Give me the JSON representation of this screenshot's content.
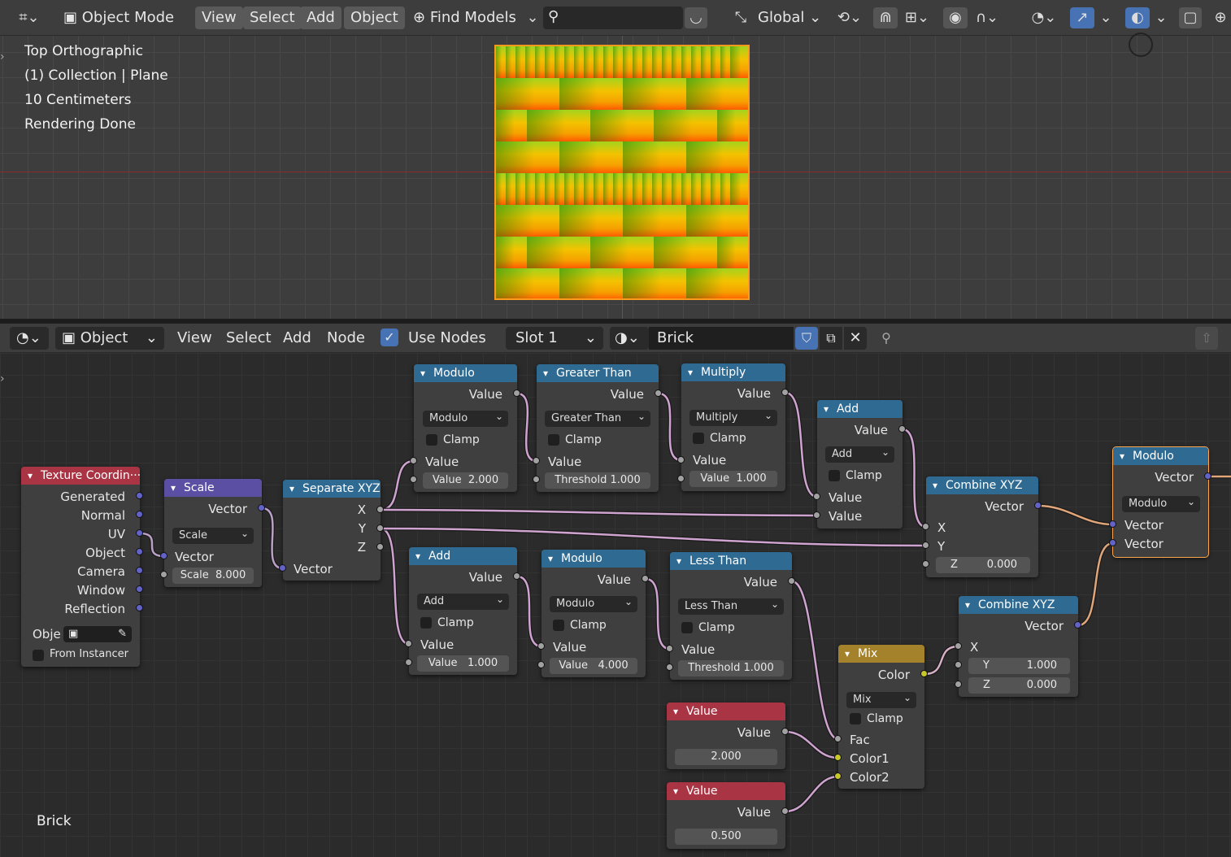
{
  "top_header": {
    "mode": "Object Mode",
    "menus": [
      "View",
      "Select",
      "Add",
      "Object"
    ],
    "find_models": "Find Models",
    "orientation": "Global"
  },
  "viewport": {
    "lines": [
      "Top Orthographic",
      "(1) Collection | Plane",
      "10 Centimeters",
      "Rendering Done"
    ]
  },
  "node_header": {
    "mode": "Object",
    "menus": [
      "View",
      "Select",
      "Add",
      "Node"
    ],
    "use_nodes": "Use Nodes",
    "slot": "Slot 1",
    "material": "Brick"
  },
  "canvas_label": "Brick",
  "nodes": {
    "texcoord": {
      "title": "Texture Coordin···",
      "outputs": [
        "Generated",
        "Normal",
        "UV",
        "Object",
        "Camera",
        "Window",
        "Reflection"
      ],
      "object_label": "Obje",
      "from_instancer": "From Instancer"
    },
    "scale": {
      "title": "Scale",
      "out": "Vector",
      "op": "Scale",
      "in": "Vector",
      "field": "Scale",
      "value": "8.000"
    },
    "sepxyz": {
      "title": "Separate XYZ",
      "x": "X",
      "y": "Y",
      "z": "Z",
      "in": "Vector"
    },
    "mod1": {
      "title": "Modulo",
      "out": "Value",
      "op": "Modulo",
      "clamp": "Clamp",
      "in": "Value",
      "field": "Value",
      "value": "2.000"
    },
    "gt": {
      "title": "Greater Than",
      "out": "Value",
      "op": "Greater Than",
      "clamp": "Clamp",
      "in": "Value",
      "field": "Threshold",
      "value": "1.000"
    },
    "mul": {
      "title": "Multiply",
      "out": "Value",
      "op": "Multiply",
      "clamp": "Clamp",
      "in": "Value",
      "field": "Value",
      "value": "1.000"
    },
    "add1": {
      "title": "Add",
      "out": "Value",
      "op": "Add",
      "clamp": "Clamp",
      "in1": "Value",
      "in2": "Value"
    },
    "comb1": {
      "title": "Combine XYZ",
      "out": "Vector",
      "x": "X",
      "y": "Y",
      "z": "Z",
      "zval": "0.000"
    },
    "mod3": {
      "title": "Modulo",
      "out": "Vector",
      "op": "Modulo",
      "in1": "Vector",
      "in2": "Vector"
    },
    "add2": {
      "title": "Add",
      "out": "Value",
      "op": "Add",
      "clamp": "Clamp",
      "in": "Value",
      "field": "Value",
      "value": "1.000"
    },
    "mod2": {
      "title": "Modulo",
      "out": "Value",
      "op": "Modulo",
      "clamp": "Clamp",
      "in": "Value",
      "field": "Value",
      "value": "4.000"
    },
    "lt": {
      "title": "Less Than",
      "out": "Value",
      "op": "Less Than",
      "clamp": "Clamp",
      "in": "Value",
      "field": "Threshold",
      "value": "1.000"
    },
    "mix": {
      "title": "Mix",
      "out": "Color",
      "op": "Mix",
      "clamp": "Clamp",
      "fac": "Fac",
      "c1": "Color1",
      "c2": "Color2"
    },
    "comb2": {
      "title": "Combine XYZ",
      "out": "Vector",
      "x": "X",
      "y": "Y",
      "yval": "1.000",
      "z": "Z",
      "zval": "0.000"
    },
    "val1": {
      "title": "Value",
      "out": "Value",
      "value": "2.000"
    },
    "val2": {
      "title": "Value",
      "out": "Value",
      "value": "0.500"
    }
  }
}
